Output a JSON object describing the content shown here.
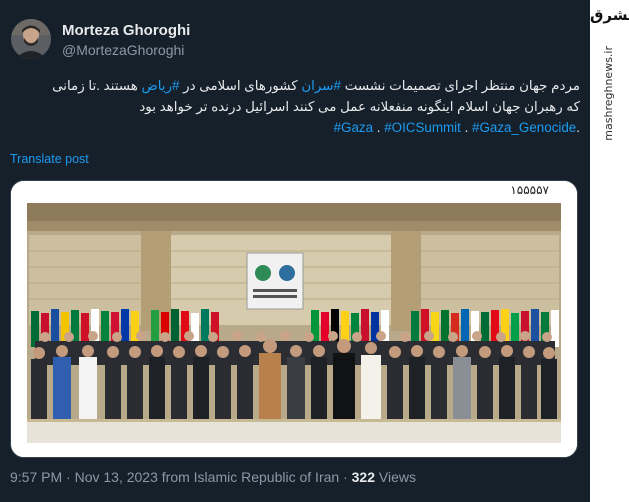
{
  "author": {
    "name": "Morteza Ghoroghi",
    "handle": "@MortezaGhoroghi"
  },
  "tweet": {
    "line1_prefix": "مردم جهان منتظر اجرای تصمیمات نشست ",
    "hashtag_saran": "#سران",
    "line1_mid": " کشورهای اسلامی در ",
    "hashtag_riyadh": "#ریاض",
    "line1_suffix": " هستند .تا زمانی",
    "line2": "که رهبران جهان اسلام اینگونه منفعلانه عمل می کنند اسرائیل درنده تر خواهد بود",
    "hashtag_gaza": "#Gaza",
    "hashtag_oic": "#OICSummit",
    "hashtag_genocide": "#Gaza_Genocide",
    "sep": " . ",
    "end": "."
  },
  "translate_label": "Translate post",
  "media": {
    "caption": "۱۵۵۵۵۷"
  },
  "meta": {
    "time": "9:57 PM",
    "date": "Nov 13, 2023",
    "source": "from Islamic Republic of Iran",
    "views_count": "322",
    "views_label": "Views",
    "dot": "·"
  },
  "watermark": {
    "logo": "مشرق",
    "url": "mashreghnews.ir"
  },
  "colors": {
    "background": "#15202b",
    "link": "#1d9bf0",
    "secondary_text": "#8b98a5"
  }
}
